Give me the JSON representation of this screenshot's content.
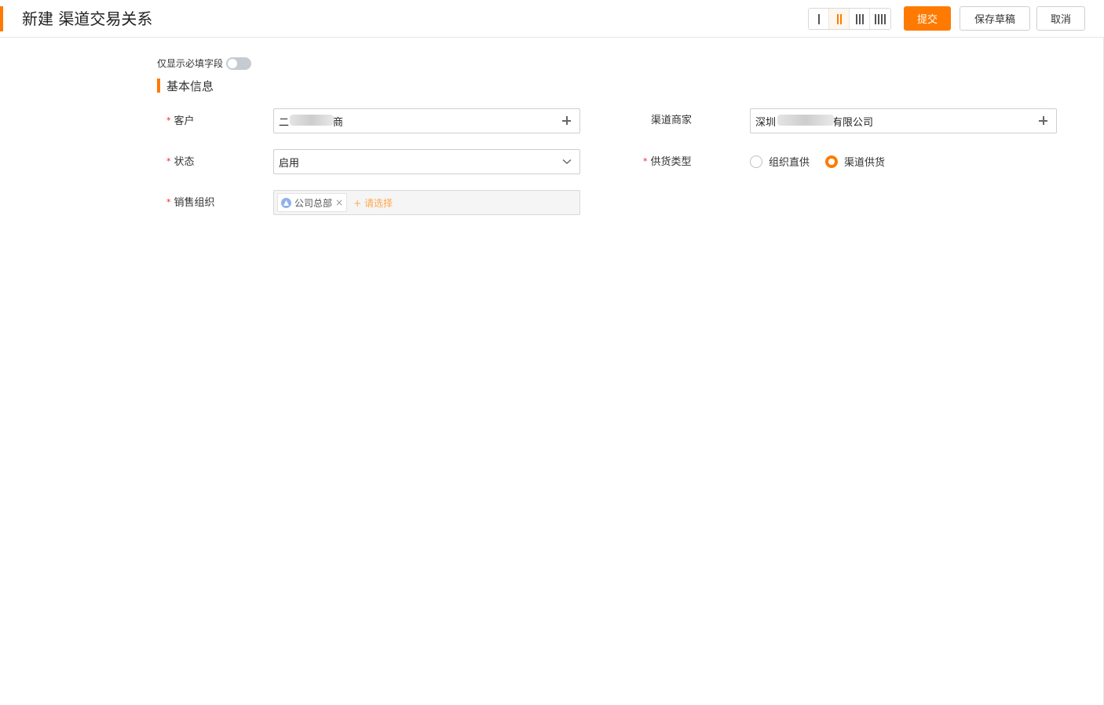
{
  "header": {
    "title": "新建 渠道交易关系",
    "actions": {
      "submit": "提交",
      "save_draft": "保存草稿",
      "cancel": "取消"
    },
    "column_options": [
      1,
      2,
      3,
      4
    ],
    "column_selected": 2
  },
  "toggle_required": {
    "label": "仅显示必填字段",
    "on": false
  },
  "section": {
    "title": "基本信息"
  },
  "fields": {
    "customer": {
      "label": "客户",
      "required": true,
      "value_start": "二",
      "value_end": "商"
    },
    "channel_merchant": {
      "label": "渠道商家",
      "required": false,
      "value_start": "深圳",
      "value_end": "有限公司"
    },
    "status": {
      "label": "状态",
      "required": true,
      "value": "启用"
    },
    "supply_type": {
      "label": "供货类型",
      "required": true,
      "options": [
        "组织直供",
        "渠道供货"
      ],
      "selected": "渠道供货"
    },
    "sales_org": {
      "label": "销售组织",
      "required": true,
      "tags": [
        "公司总部"
      ],
      "add_label": "+ 请选择"
    }
  },
  "colors": {
    "accent": "#ff7a00",
    "required_star": "#f5222d",
    "add_link": "#ffa64d"
  }
}
